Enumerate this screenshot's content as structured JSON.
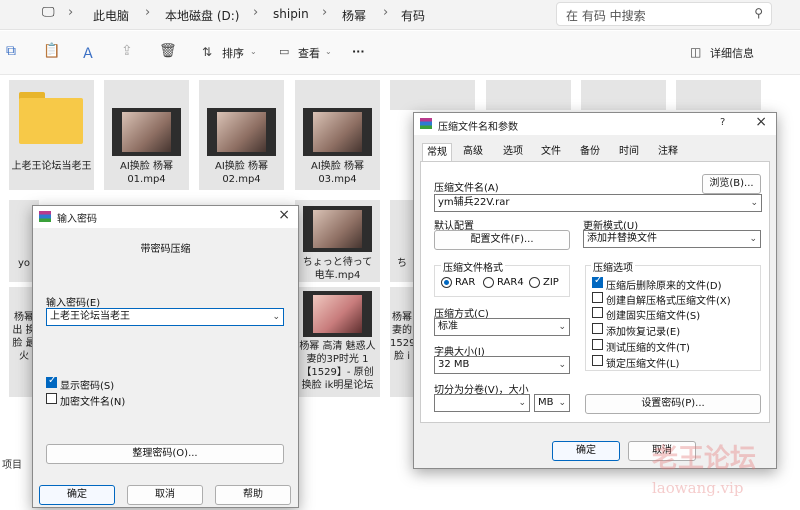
{
  "address": {
    "crumbs": [
      "此电脑",
      "本地磁盘 (D:)",
      "shipin",
      "杨幂",
      "有码"
    ],
    "search_placeholder": "在 有码 中搜索"
  },
  "toolbar": {
    "sort_label": "排序",
    "view_label": "查看",
    "more_label": "···",
    "details_label": "详细信息"
  },
  "files": {
    "folder_name": "上老王论坛当老王",
    "video1": "AI换脸 杨幂 01.mp4",
    "video2": "AI换脸 杨幂 02.mp4",
    "video3": "AI换脸 杨幂 03.mp4",
    "video_mid": "ちょっと待って 电车.mp4",
    "video_bottom": "杨幂 高清 魅惑人妻的3P时光 1【1529】- 原创换脸 ik明星论坛_...",
    "left_partial_1": "yo",
    "left_partial_2": "杨幂 出 换脸 最火",
    "right_partial_1": "ち",
    "right_partial_2": "杨幂 妻的 1529 脸 i",
    "statusbar": "项目"
  },
  "pwd_dialog": {
    "title": "输入密码",
    "subtitle": "带密码压缩",
    "input_label": "输入密码(E)",
    "input_value": "上老王论坛当老王",
    "show_password": "显示密码(S)",
    "show_password_checked": true,
    "encrypt_names": "加密文件名(N)",
    "encrypt_names_checked": false,
    "manage_button": "整理密码(O)...",
    "ok": "确定",
    "cancel": "取消",
    "help": "帮助"
  },
  "archive_dialog": {
    "title": "压缩文件名和参数",
    "help_mark": "?",
    "tabs": [
      "常规",
      "高级",
      "选项",
      "文件",
      "备份",
      "时间",
      "注释"
    ],
    "name_label": "压缩文件名(A)",
    "browse": "浏览(B)...",
    "name_value": "ym辅兵22V.rar",
    "profile_label": "默认配置",
    "profile_button": "配置文件(F)...",
    "update_label": "更新模式(U)",
    "update_value": "添加并替换文件",
    "format_label": "压缩文件格式",
    "formats": [
      "RAR",
      "RAR4",
      "ZIP"
    ],
    "format_selected": 0,
    "method_label": "压缩方式(C)",
    "method_value": "标准",
    "dict_label": "字典大小(I)",
    "dict_value": "32 MB",
    "split_label": "切分为分卷(V)，大小",
    "split_unit": "MB",
    "options_label": "压缩选项",
    "options": [
      {
        "label": "压缩后删除原来的文件(D)",
        "checked": true
      },
      {
        "label": "创建自解压格式压缩文件(X)",
        "checked": false
      },
      {
        "label": "创建固实压缩文件(S)",
        "checked": false
      },
      {
        "label": "添加恢复记录(E)",
        "checked": false
      },
      {
        "label": "测试压缩的文件(T)",
        "checked": false
      },
      {
        "label": "锁定压缩文件(L)",
        "checked": false
      }
    ],
    "set_password": "设置密码(P)...",
    "ok": "确定",
    "cancel": "取消"
  },
  "watermark": {
    "line1": "老王论坛",
    "line2": "laowang.vip"
  }
}
